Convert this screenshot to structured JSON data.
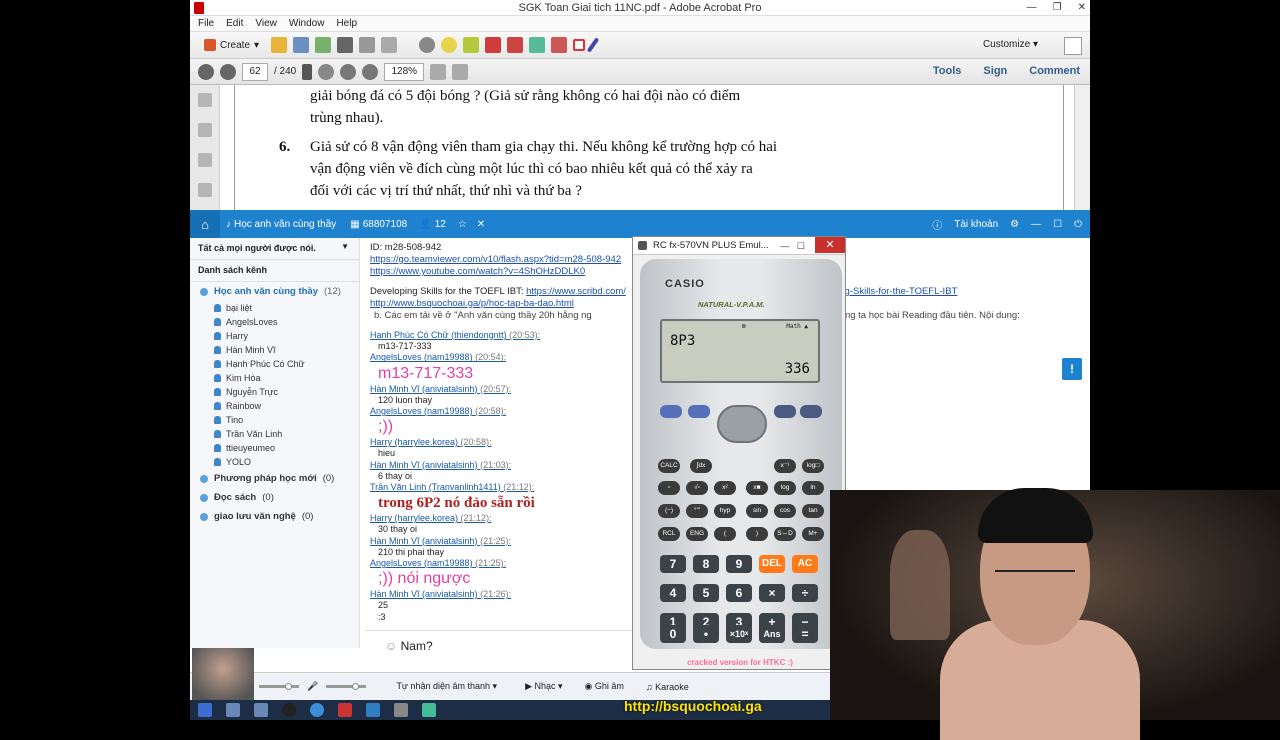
{
  "acrobat": {
    "title": "SGK Toan Giai tich 11NC.pdf - Adobe Acrobat Pro",
    "menu": [
      "File",
      "Edit",
      "View",
      "Window",
      "Help"
    ],
    "create_label": "Create",
    "customize_label": "Customize",
    "page_current": "62",
    "page_total": "/ 240",
    "zoom": "128%",
    "right_links": [
      "Tools",
      "Sign",
      "Comment"
    ],
    "pdf_lines": [
      "giải bóng đá có 5 đội bóng ? (Giả sử rằng không có hai đội nào có điểm",
      "trùng nhau).",
      "Giả sử có 8 vận động viên tham gia chạy thi. Nếu không kể trường hợp có hai",
      "vận động viên về đích cùng một lúc thì có bao nhiêu kết quả có thể xảy ra",
      "đối với các vị trí thứ nhất, thứ nhì và thứ ba ?"
    ],
    "exercise_number": "6."
  },
  "chat": {
    "header_title": "Học anh văn cùng thầy",
    "room_id": "68807108",
    "users_count": "12",
    "account_label": "Tài khoản",
    "filter_label": "Tất cả mọi người được nói.",
    "channel_list_label": "Danh sách kênh",
    "groups": [
      {
        "name": "Học anh văn cùng thầy",
        "count": "(12)"
      },
      {
        "name": "Phương pháp học mới",
        "count": "(0)"
      },
      {
        "name": "Đọc sách",
        "count": "(0)"
      },
      {
        "name": "giao lưu văn nghệ",
        "count": "(0)"
      }
    ],
    "members": [
      "bại liệt",
      "AngelsLoves",
      "Harry",
      "Hàn Minh Vĩ",
      "Hạnh Phúc Có Chữ",
      "Kim Hòa",
      "Nguyễn Trực",
      "Rainbow",
      "Tino",
      "Trần Văn Linh",
      "ttieuyeumeo",
      "YOLO"
    ],
    "info_lines": [
      "ID: m28-508-942",
      "https://go.teamviewer.com/v10/flash.aspx?tid=m28-508-942",
      "https://www.youtube.com/watch?v=4ShOHzDDLK0",
      "Developing Skills for the TOEFL IBT: ",
      "https://www.scribd.com/",
      "g-Skills-for-the-TOEFL-IBT",
      "http://www.bsquochoai.ga/p/hoc-tap-ba-dao.html",
      "b. Các em tải về ở \"Anh văn cùng thầy 20h hằng ng",
      "hai chúng ta học bài Reading đầu tiên. Nội dung:"
    ],
    "messages": [
      {
        "sender": "Hạnh Phúc Có Chữ (thiendongntt)",
        "time": "(20:53):",
        "text": "m13-717-333",
        "style": "normal"
      },
      {
        "sender": "AngelsLoves (nam19988)",
        "time": "(20:54):",
        "text": "m13-717-333",
        "style": "pink"
      },
      {
        "sender": "Hàn Minh Vĩ (aniviatalsinh)",
        "time": "(20:57):",
        "text": "120 luon thay",
        "style": "normal"
      },
      {
        "sender": "AngelsLoves (nam19988)",
        "time": "(20:58):",
        "text": ";))",
        "style": "pink"
      },
      {
        "sender": "Harry (harrylee.korea)",
        "time": "(20:58):",
        "text": "hieu",
        "style": "normal"
      },
      {
        "sender": "Hàn Minh Vĩ (aniviatalsinh)",
        "time": "(21:03):",
        "text": "6 thay oi",
        "style": "normal"
      },
      {
        "sender": "Trần Văn Linh (Tranvanlinh1411)",
        "time": "(21:12):",
        "text": "trong 6P2 nó đảo sẵn rồi",
        "style": "red"
      },
      {
        "sender": "Harry (harrylee.korea)",
        "time": "(21:12):",
        "text": "30 thay oi",
        "style": "normal"
      },
      {
        "sender": "Hàn Minh Vĩ (aniviatalsinh)",
        "time": "(21:25):",
        "text": "210 thi phai thay",
        "style": "normal"
      },
      {
        "sender": "AngelsLoves (nam19988)",
        "time": "(21:25):",
        "text": ";)) nói ngược",
        "style": "pink"
      },
      {
        "sender": "Hàn Minh Vĩ (aniviatalsinh)",
        "time": "(21:26):",
        "text": "25",
        "style": "normal"
      }
    ],
    "extra_line": ":3",
    "input_text": "Nam?",
    "bottom_bar": {
      "voice_mode": "Tự nhận diện âm thanh",
      "music": "Nhạc",
      "record": "Ghi âm",
      "karaoke": "Karaoke"
    }
  },
  "calculator": {
    "title": "RC fx-570VN PLUS Emul...",
    "brand": "CASIO",
    "model_tag": "NATURAL-V.P.A.M.",
    "expression": "8P3",
    "result": "336",
    "indicator": "Math",
    "cracked_note": "cracked version for HTKC :)",
    "func_rows": [
      [
        "CALC",
        "∫dx",
        "x⁻¹",
        "log□"
      ],
      [
        "▫",
        "√▫",
        "x²",
        "x■",
        "log",
        "ln"
      ],
      [
        "(−)",
        "°'\"",
        "hyp",
        "sin",
        "cos",
        "tan"
      ],
      [
        "RCL",
        "ENG",
        "(",
        ")",
        "S⇔D",
        "M+"
      ]
    ],
    "keys": [
      [
        "7",
        "8",
        "9",
        "DEL",
        "AC"
      ],
      [
        "4",
        "5",
        "6",
        "×",
        "÷"
      ],
      [
        "1",
        "2",
        "3",
        "+",
        "−"
      ],
      [
        "0",
        "•",
        "×10ˣ",
        "Ans",
        "="
      ]
    ]
  },
  "watermark_url": "http://bsquochoai.ga"
}
